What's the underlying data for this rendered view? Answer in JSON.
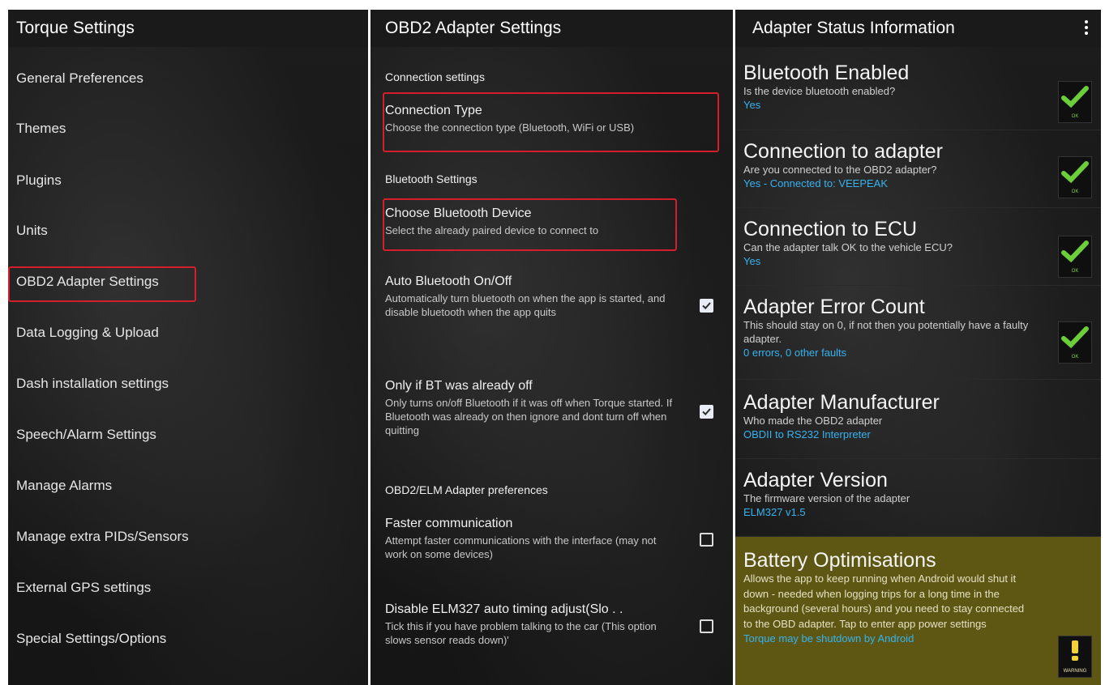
{
  "panel1": {
    "title": "Torque Settings",
    "items": [
      "General Preferences",
      "Themes",
      "Plugins",
      "Units",
      "OBD2 Adapter Settings",
      "Data Logging & Upload",
      "Dash installation settings",
      "Speech/Alarm Settings",
      "Manage Alarms",
      "Manage extra PIDs/Sensors",
      "External GPS settings",
      "Special Settings/Options"
    ]
  },
  "panel2": {
    "title": "OBD2 Adapter Settings",
    "section_connection": "Connection settings",
    "connection_type": {
      "title": "Connection Type",
      "summary": "Choose the connection type (Bluetooth, WiFi or USB)"
    },
    "section_bluetooth": "Bluetooth Settings",
    "choose_device": {
      "title": "Choose Bluetooth Device",
      "summary": "Select the already paired device to connect to"
    },
    "auto_bt": {
      "title": "Auto Bluetooth On/Off",
      "summary": "Automatically turn bluetooth on when the app is started, and disable bluetooth when the app quits",
      "checked": true
    },
    "only_if_off": {
      "title": "Only if BT was already off",
      "summary": "Only turns on/off Bluetooth if it was off when Torque started. If Bluetooth was already on then ignore and dont turn off when quitting",
      "checked": true
    },
    "section_elm": "OBD2/ELM Adapter preferences",
    "faster": {
      "title": "Faster communication",
      "summary": "Attempt faster communications with the interface (may not work on some devices)",
      "checked": false
    },
    "disable_timing": {
      "title": "Disable ELM327 auto timing adjust(Slo . .",
      "summary": "Tick this if you have problem talking to the car (This option slows sensor reads down)'",
      "checked": false
    }
  },
  "panel3": {
    "title": "Adapter Status Information",
    "status_color_value": "#35b3f0",
    "warning_background": "#5e5713",
    "items": [
      {
        "heading": "Bluetooth Enabled",
        "description": "Is the device bluetooth enabled?",
        "value": "Yes",
        "badge": "OK"
      },
      {
        "heading": "Connection to adapter",
        "description": "Are you connected to the OBD2 adapter?",
        "value": "Yes - Connected to: VEEPEAK",
        "badge": "OK"
      },
      {
        "heading": "Connection to ECU",
        "description": "Can the adapter talk OK to the vehicle ECU?",
        "value": "Yes",
        "badge": "OK"
      },
      {
        "heading": "Adapter Error Count",
        "description": "This should stay on 0, if not then you potentially have a faulty adapter.",
        "value": "0 errors, 0 other faults",
        "badge": "OK"
      },
      {
        "heading": "Adapter Manufacturer",
        "description": "Who made the OBD2 adapter",
        "value": "OBDII to RS232 Interpreter"
      },
      {
        "heading": "Adapter Version",
        "description": "The firmware version of the adapter",
        "value": "ELM327 v1.5"
      },
      {
        "heading": "Battery Optimisations",
        "description": "Allows the app to keep running when Android would shut it down - needed when logging trips for a long time in the background (several hours) and you need to stay connected to the OBD adapter. Tap to enter app power settings",
        "value": "Torque may be shutdown by Android",
        "badge": "WARNING"
      }
    ]
  }
}
